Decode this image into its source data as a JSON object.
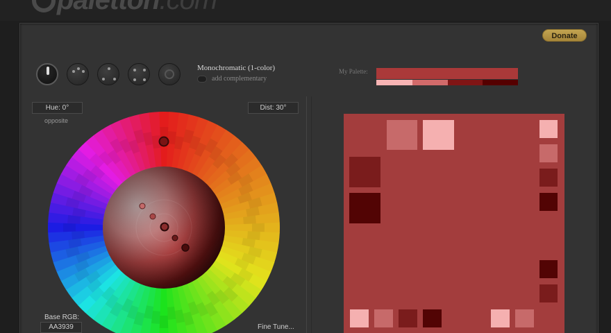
{
  "app": {
    "logo_text": "paletton",
    "logo_suffix": ".com"
  },
  "header": {
    "donate_label": "Donate"
  },
  "scheme": {
    "label": "Monochromatic (1-color)",
    "complementary_label": "add complementary",
    "knobs": [
      {
        "name": "mono",
        "icon": "mono-knob-icon",
        "active": true
      },
      {
        "name": "adjacent",
        "icon": "adjacent-knob-icon",
        "active": false
      },
      {
        "name": "triad",
        "icon": "triad-knob-icon",
        "active": false
      },
      {
        "name": "tetrad",
        "icon": "tetrad-knob-icon",
        "active": false
      },
      {
        "name": "free",
        "icon": "free-style-knob-icon",
        "active": false
      }
    ]
  },
  "wheel": {
    "hue_label": "Hue: 0°",
    "dist_label": "Dist: 30°",
    "opposite_label": "opposite",
    "base_rgb_label": "Base RGB:",
    "base_rgb_value": "AA3939",
    "fine_tune_label": "Fine Tune..."
  },
  "palette": {
    "label": "My Palette:",
    "main": "#AA3939",
    "shades": [
      "#F8B4B4",
      "#D26A6A",
      "#801515",
      "#550000"
    ]
  },
  "colors": {
    "base": "#A33D3D",
    "lightest": "#F5B0B0",
    "light": "#C76A6A",
    "dark": "#7A1C1C",
    "darkest": "#520404",
    "accent": "#B9994A",
    "panel": "#333333"
  }
}
